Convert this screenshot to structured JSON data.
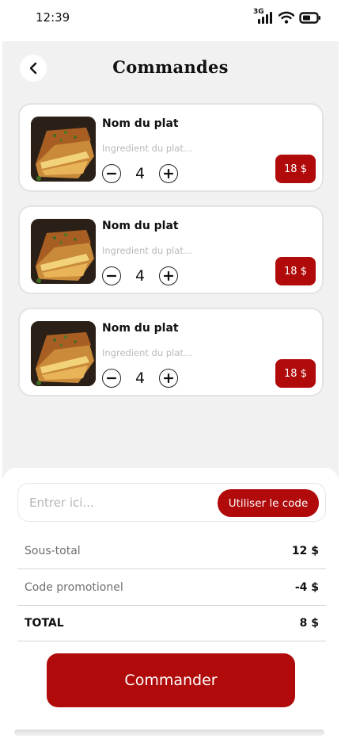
{
  "status_bar": {
    "time": "12:39",
    "network": "3G",
    "icons": [
      "signal-icon",
      "wifi-icon",
      "battery-icon"
    ]
  },
  "header": {
    "title": "Commandes",
    "back_icon": "chevron-left-icon"
  },
  "order_items": [
    {
      "name": "Nom du plat",
      "ingredients": "Ingredient du plat...",
      "quantity": "4",
      "price": "18 $",
      "image": "lasagna-photo"
    },
    {
      "name": "Nom du plat",
      "ingredients": "Ingredient du plat...",
      "quantity": "4",
      "price": "18 $",
      "image": "lasagna-photo"
    },
    {
      "name": "Nom du plat",
      "ingredients": "Ingredient du plat...",
      "quantity": "4",
      "price": "18 $",
      "image": "lasagna-photo"
    }
  ],
  "promo": {
    "placeholder": "Entrer ici...",
    "button_label": "Utiliser le code"
  },
  "summary": {
    "subtotal_label": "Sous-total",
    "subtotal_value": "12 $",
    "promo_label": "Code promotionel",
    "promo_value": "-4 $",
    "total_label": "TOTAL",
    "total_value": "8 $"
  },
  "order_button": {
    "label": "Commander"
  },
  "colors": {
    "accent": "#b00a0a",
    "screen_bg": "#f1f1f1",
    "card_border": "#e3e3e3"
  }
}
